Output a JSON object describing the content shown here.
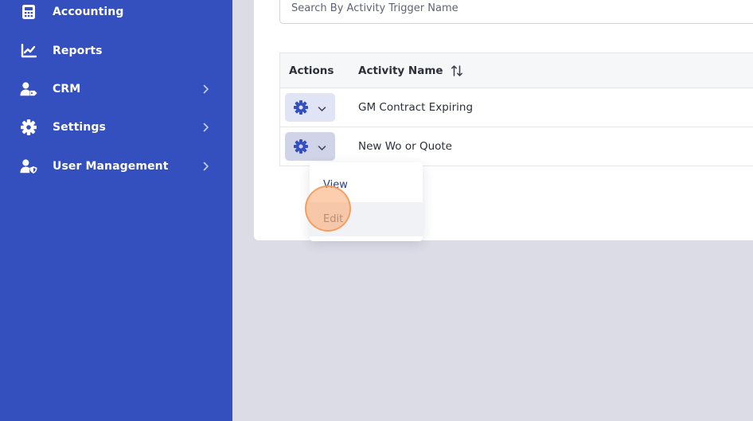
{
  "sidebar": {
    "items": [
      {
        "label": "Accounting",
        "icon": "calculator-icon",
        "has_submenu": false
      },
      {
        "label": "Reports",
        "icon": "chart-line-icon",
        "has_submenu": false
      },
      {
        "label": "CRM",
        "icon": "user-tag-icon",
        "has_submenu": true
      },
      {
        "label": "Settings",
        "icon": "gear-icon",
        "has_submenu": true
      },
      {
        "label": "User Management",
        "icon": "user-shield-icon",
        "has_submenu": true
      }
    ]
  },
  "search": {
    "placeholder": "Search By Activity Trigger Name",
    "value": ""
  },
  "table": {
    "columns": {
      "actions": "Actions",
      "activity_name": "Activity Name"
    },
    "rows": [
      {
        "activity_name": "GM Contract Expiring"
      },
      {
        "activity_name": "New Wo or Quote"
      }
    ]
  },
  "dropdown": {
    "items": [
      {
        "label": "View"
      },
      {
        "label": "Edit"
      }
    ],
    "hovered_item": "Edit"
  },
  "colors": {
    "sidebar_bg": "#3450bf",
    "accent": "#3450bf",
    "page_bg": "#dcdce6",
    "click_highlight": "#f7a566"
  }
}
